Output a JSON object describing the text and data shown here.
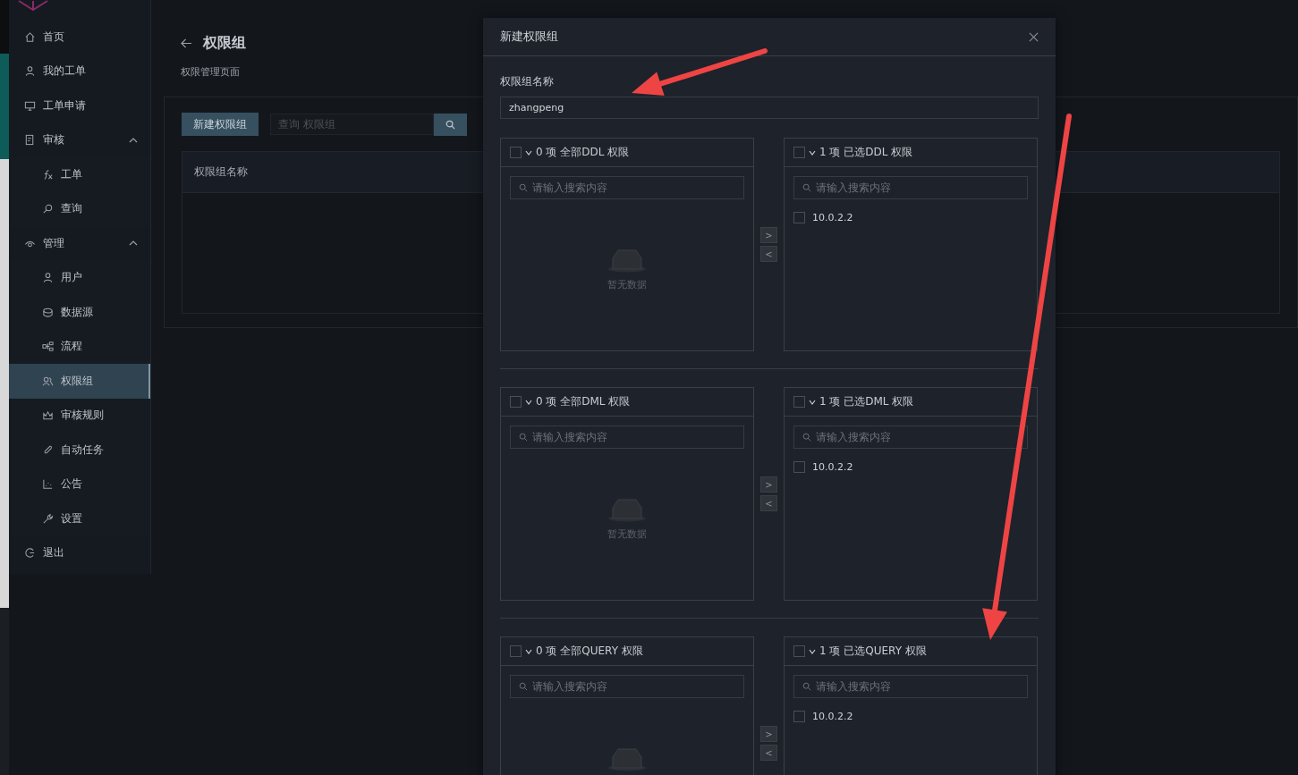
{
  "sidebar": {
    "items": [
      {
        "label": "首页",
        "selected": false
      },
      {
        "label": "我的工单",
        "selected": false
      },
      {
        "label": "工单申请",
        "selected": false
      },
      {
        "label": "审核",
        "selected": false,
        "expanded": true,
        "children": [
          {
            "label": "工单",
            "selected": false
          },
          {
            "label": "查询",
            "selected": false
          }
        ]
      },
      {
        "label": "管理",
        "selected": false,
        "expanded": true,
        "children": [
          {
            "label": "用户",
            "selected": false
          },
          {
            "label": "数据源",
            "selected": false
          },
          {
            "label": "流程",
            "selected": false
          },
          {
            "label": "权限组",
            "selected": true
          },
          {
            "label": "审核规则",
            "selected": false
          },
          {
            "label": "自动任务",
            "selected": false
          },
          {
            "label": "公告",
            "selected": false
          },
          {
            "label": "设置",
            "selected": false
          }
        ]
      },
      {
        "label": "退出",
        "selected": false
      }
    ]
  },
  "page": {
    "title": "权限组",
    "subtitle": "权限管理页面",
    "new_button": "新建权限组",
    "search": {
      "placeholder": "查询 权限组"
    },
    "table": {
      "columns": [
        "权限组名称"
      ]
    }
  },
  "dialog": {
    "title": "新建权限组",
    "name_field": {
      "label": "权限组名称",
      "value": "zhangpeng"
    },
    "transfers": [
      {
        "source": {
          "checked": false,
          "header": "0 项 全部DDL 权限",
          "search_placeholder": "请输入搜索内容",
          "empty_text": "暂无数据"
        },
        "target": {
          "checked": false,
          "header": "1 项 已选DDL 权限",
          "search_placeholder": "请输入搜索内容",
          "items": [
            {
              "label": "10.0.2.2",
              "checked": false
            }
          ]
        },
        "buttons": [
          ">",
          "<"
        ]
      },
      {
        "source": {
          "checked": false,
          "header": "0 项 全部DML 权限",
          "search_placeholder": "请输入搜索内容",
          "empty_text": "暂无数据"
        },
        "target": {
          "checked": false,
          "header": "1 项 已选DML 权限",
          "search_placeholder": "请输入搜索内容",
          "items": [
            {
              "label": "10.0.2.2",
              "checked": false
            }
          ]
        },
        "buttons": [
          ">",
          "<"
        ]
      },
      {
        "source": {
          "checked": false,
          "header": "0 项 全部QUERY 权限",
          "search_placeholder": "请输入搜索内容"
        },
        "target": {
          "checked": false,
          "header": "1 项 已选QUERY 权限",
          "search_placeholder": "请输入搜索内容",
          "items": [
            {
              "label": "10.0.2.2",
              "checked": false
            }
          ]
        },
        "buttons": [
          ">",
          "<"
        ]
      }
    ]
  }
}
